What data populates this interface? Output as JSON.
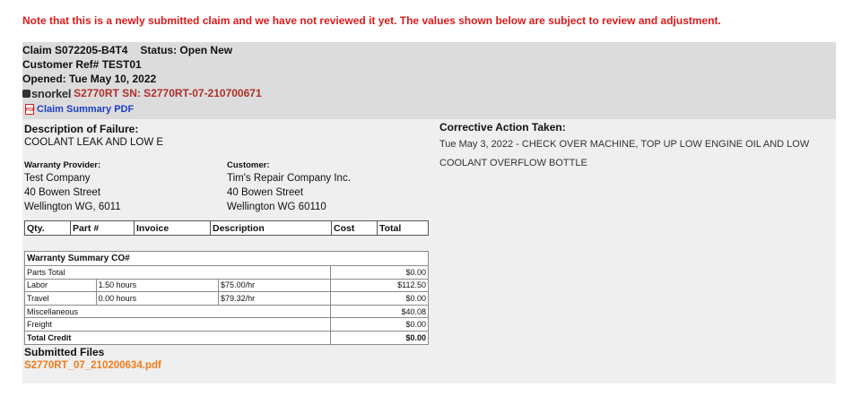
{
  "notice": "Note that this is a newly submitted claim and we have not reviewed it yet. The values shown below are subject to review and adjustment.",
  "claim": {
    "number": "Claim S072205-B4T4",
    "status": "Status: Open New",
    "customer_ref": "Customer Ref# TEST01",
    "opened": "Opened: Tue May 10, 2022",
    "brand": "snorkel",
    "serial": "S2770RT SN: S2770RT-07-210700671",
    "pdf_link": "Claim Summary PDF",
    "pdf_icon_text": "PDF"
  },
  "failure": {
    "label": "Description of Failure:",
    "text": "COOLANT LEAK AND LOW E"
  },
  "corrective": {
    "label": "Corrective Action Taken:",
    "text": "Tue May 3, 2022 - CHECK OVER MACHINE, TOP UP LOW ENGINE OIL AND LOW COOLANT OVERFLOW BOTTLE"
  },
  "warranty_provider": {
    "label": "Warranty Provider:",
    "lines": [
      "Test Company",
      "40 Bowen Street",
      "Wellington WG, 6011"
    ]
  },
  "customer": {
    "label": "Customer:",
    "lines": [
      "Tim's Repair Company Inc.",
      "40 Bowen Street",
      "Wellington WG 60110"
    ]
  },
  "parts_table": {
    "headers": [
      "Qty.",
      "Part #",
      "Invoice",
      "Description",
      "Cost",
      "Total"
    ]
  },
  "summary": {
    "title": "Warranty Summary CO#",
    "parts_total": {
      "label": "Parts Total",
      "value": "$0.00"
    },
    "labor": {
      "label": "Labor",
      "hours": "1.50 hours",
      "rate": "$75.00/hr",
      "value": "$112.50"
    },
    "travel": {
      "label": "Travel",
      "hours": "0.00 hours",
      "rate": "$79.32/hr",
      "value": "$0.00"
    },
    "misc": {
      "label": "Miscellaneous",
      "value": "$40.08"
    },
    "freight": {
      "label": "Freight",
      "value": "$0.00"
    },
    "total_credit": {
      "label": "Total Credit",
      "value": "$0.00"
    }
  },
  "files": {
    "label": "Submitted Files",
    "items": [
      "S2770RT_07_210200634.pdf"
    ]
  },
  "colors": {
    "notice": "#d81b1b",
    "serial": "#b0302a",
    "link": "#1a3fc7",
    "file_link": "#f07c1c",
    "header_band": "#dcdcdc",
    "panel": "#efefef"
  }
}
